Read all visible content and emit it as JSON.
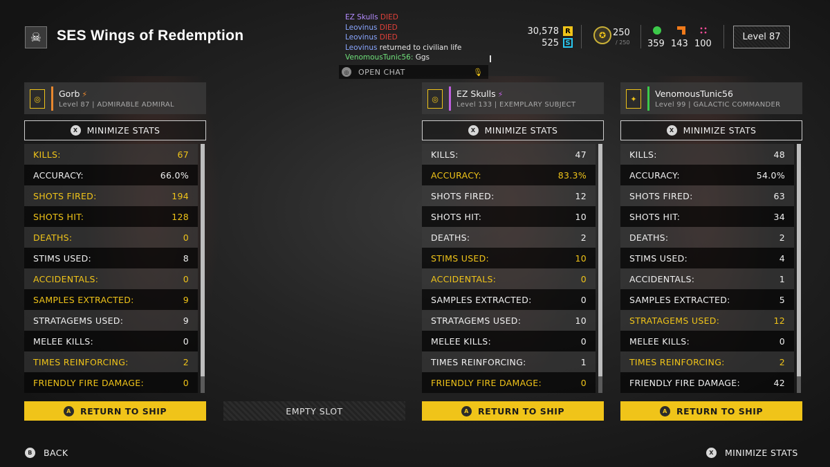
{
  "header": {
    "skull_icon": "skull-icon",
    "ship_name": "SES Wings of Redemption"
  },
  "chat": {
    "lines": [
      {
        "name": "EZ Skulls",
        "name_color": "#b48cff",
        "text": " DIED",
        "text_color": "#e0413a"
      },
      {
        "name": "Leovinus",
        "name_color": "#8aa6ff",
        "text": " DIED",
        "text_color": "#e0413a"
      },
      {
        "name": "Leovinus",
        "name_color": "#8aa6ff",
        "text": " DIED",
        "text_color": "#e0413a"
      },
      {
        "name": "Leovinus",
        "name_color": "#8aa6ff",
        "text": " returned to civilian life",
        "text_color": "#e8e8e8"
      },
      {
        "name": "VenomousTunic56:",
        "name_color": "#6fe07a",
        "text": " Ggs",
        "text_color": "#e8e8e8"
      }
    ],
    "open_chat_label": "OPEN CHAT"
  },
  "currency": {
    "requisition": "30,578",
    "requisition_icon": "R",
    "super_credits": "525",
    "super_credits_icon": "S",
    "medals": "250",
    "medals_cap": "/ 250",
    "common_samples": "359",
    "rare_samples": "143",
    "super_samples": "100",
    "level": "Level 87"
  },
  "players": [
    {
      "name": "Gorb",
      "rank": "Level 87 | ADMIRABLE ADMIRAL",
      "accent": "#e8872e",
      "minimize_label": "MINIMIZE STATS",
      "minimize_key": "X",
      "return_label": "RETURN TO SHIP",
      "return_key": "A",
      "stats": [
        {
          "label": "KILLS:",
          "value": "67",
          "hl": true
        },
        {
          "label": "ACCURACY:",
          "value": "66.0%",
          "hl": false
        },
        {
          "label": "SHOTS FIRED:",
          "value": "194",
          "hl": true
        },
        {
          "label": "SHOTS HIT:",
          "value": "128",
          "hl": true
        },
        {
          "label": "DEATHS:",
          "value": "0",
          "hl": true
        },
        {
          "label": "STIMS USED:",
          "value": "8",
          "hl": false
        },
        {
          "label": "ACCIDENTALS:",
          "value": "0",
          "hl": true
        },
        {
          "label": "SAMPLES EXTRACTED:",
          "value": "9",
          "hl": true
        },
        {
          "label": "STRATAGEMS USED:",
          "value": "9",
          "hl": false
        },
        {
          "label": "MELEE KILLS:",
          "value": "0",
          "hl": false
        },
        {
          "label": "TIMES REINFORCING:",
          "value": "2",
          "hl": true
        },
        {
          "label": "FRIENDLY FIRE DAMAGE:",
          "value": "0",
          "hl": true
        }
      ]
    },
    {
      "name": "EZ Skulls",
      "rank": "Level 133 | EXEMPLARY SUBJECT",
      "accent": "#c060e0",
      "minimize_label": "MINIMIZE STATS",
      "minimize_key": "X",
      "return_label": "RETURN TO SHIP",
      "return_key": "A",
      "stats": [
        {
          "label": "KILLS:",
          "value": "47",
          "hl": false
        },
        {
          "label": "ACCURACY:",
          "value": "83.3%",
          "hl": true
        },
        {
          "label": "SHOTS FIRED:",
          "value": "12",
          "hl": false
        },
        {
          "label": "SHOTS HIT:",
          "value": "10",
          "hl": false
        },
        {
          "label": "DEATHS:",
          "value": "2",
          "hl": false
        },
        {
          "label": "STIMS USED:",
          "value": "10",
          "hl": true
        },
        {
          "label": "ACCIDENTALS:",
          "value": "0",
          "hl": true
        },
        {
          "label": "SAMPLES EXTRACTED:",
          "value": "0",
          "hl": false
        },
        {
          "label": "STRATAGEMS USED:",
          "value": "10",
          "hl": false
        },
        {
          "label": "MELEE KILLS:",
          "value": "0",
          "hl": false
        },
        {
          "label": "TIMES REINFORCING:",
          "value": "1",
          "hl": false
        },
        {
          "label": "FRIENDLY FIRE DAMAGE:",
          "value": "0",
          "hl": true
        }
      ]
    },
    {
      "name": "VenomousTunic56",
      "rank": "Level 99 | GALACTIC COMMANDER",
      "accent": "#3cc94a",
      "minimize_label": "MINIMIZE STATS",
      "minimize_key": "X",
      "return_label": "RETURN TO SHIP",
      "return_key": "A",
      "stats": [
        {
          "label": "KILLS:",
          "value": "48",
          "hl": false
        },
        {
          "label": "ACCURACY:",
          "value": "54.0%",
          "hl": false
        },
        {
          "label": "SHOTS FIRED:",
          "value": "63",
          "hl": false
        },
        {
          "label": "SHOTS HIT:",
          "value": "34",
          "hl": false
        },
        {
          "label": "DEATHS:",
          "value": "2",
          "hl": false
        },
        {
          "label": "STIMS USED:",
          "value": "4",
          "hl": false
        },
        {
          "label": "ACCIDENTALS:",
          "value": "1",
          "hl": false
        },
        {
          "label": "SAMPLES EXTRACTED:",
          "value": "5",
          "hl": false
        },
        {
          "label": "STRATAGEMS USED:",
          "value": "12",
          "hl": true
        },
        {
          "label": "MELEE KILLS:",
          "value": "0",
          "hl": false
        },
        {
          "label": "TIMES REINFORCING:",
          "value": "2",
          "hl": true
        },
        {
          "label": "FRIENDLY FIRE DAMAGE:",
          "value": "42",
          "hl": false
        }
      ]
    }
  ],
  "empty_slot_label": "EMPTY SLOT",
  "footer": {
    "back_key": "B",
    "back_label": "BACK",
    "minimize_key": "X",
    "minimize_label": "MINIMIZE STATS"
  },
  "colors": {
    "highlight": "#f0c419",
    "button_yellow": "#f0c419"
  }
}
